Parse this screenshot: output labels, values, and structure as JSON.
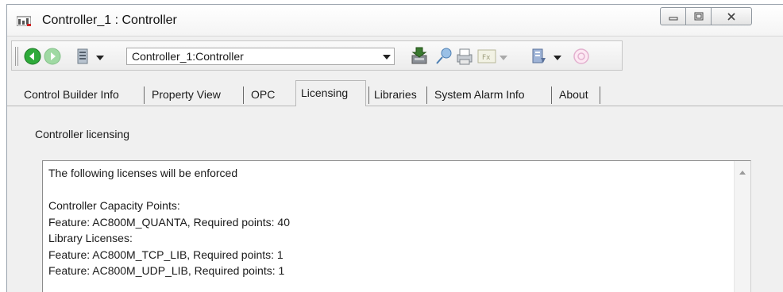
{
  "window": {
    "title": "Controller_1 : Controller"
  },
  "toolbar": {
    "combo_value": "Controller_1:Controller",
    "icons": [
      "back-icon",
      "forward-icon",
      "controller-icon",
      "download-icon",
      "pin-icon",
      "print-icon",
      "function-icon",
      "library-icon",
      "online-icon"
    ]
  },
  "tabs": [
    {
      "label": "Control Builder Info",
      "active": false
    },
    {
      "label": "Property View",
      "active": false
    },
    {
      "label": "OPC",
      "active": false
    },
    {
      "label": "Licensing",
      "active": true
    },
    {
      "label": "Libraries",
      "active": false
    },
    {
      "label": "System Alarm Info",
      "active": false
    },
    {
      "label": "About",
      "active": false
    }
  ],
  "licensing": {
    "section_label": "Controller licensing",
    "lines": [
      "The following licenses will be enforced",
      "",
      "Controller Capacity Points:",
      "Feature: AC800M_QUANTA, Required points: 40",
      "Library Licenses:",
      "Feature: AC800M_TCP_LIB, Required points: 1",
      "Feature: AC800M_UDP_LIB, Required points: 1"
    ]
  },
  "colors": {
    "accent_green": "#2eaa3a",
    "window_bg": "#f0f0f0"
  }
}
